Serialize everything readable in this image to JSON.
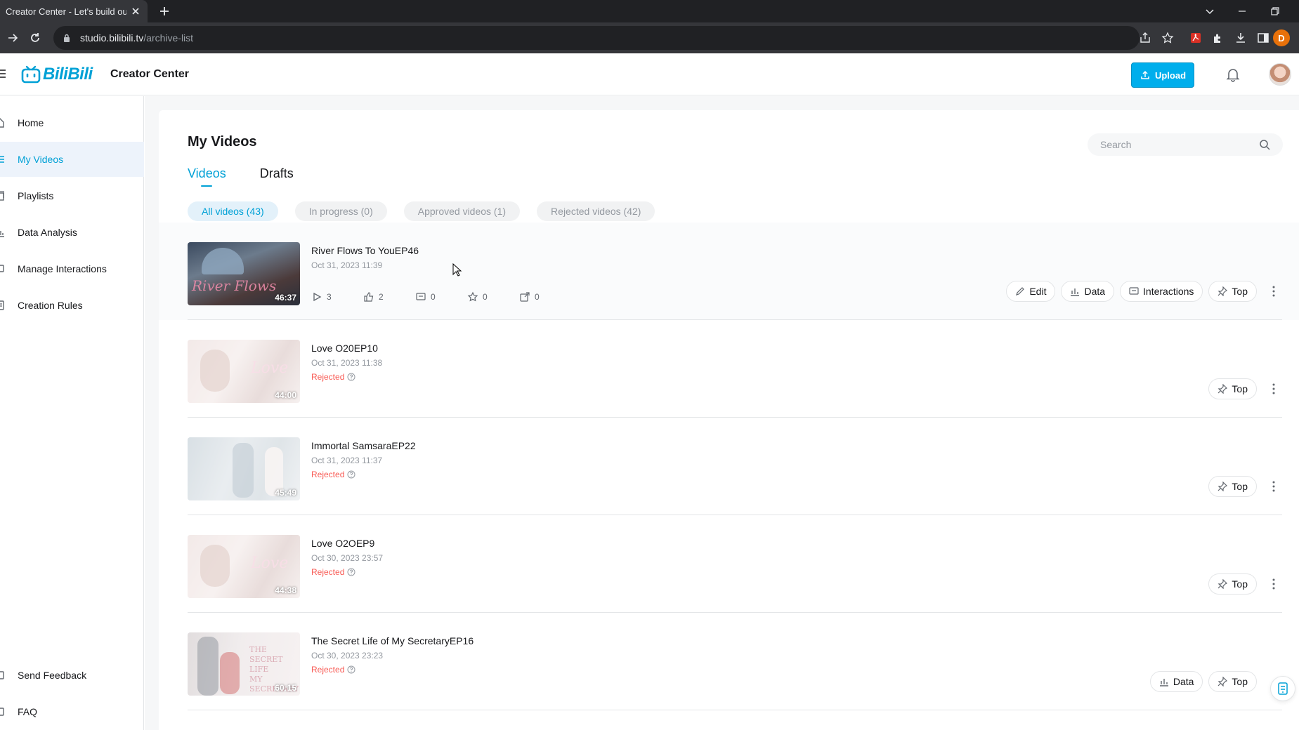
{
  "browser": {
    "tab_title": "Creator Center - Let's build our",
    "url_host": "studio.bilibili.tv",
    "url_path": "/archive-list",
    "profile_initial": "D"
  },
  "header": {
    "logo_text": "BiliBili",
    "title": "Creator Center",
    "upload_label": "Upload"
  },
  "sidebar": {
    "items": [
      {
        "label": "Home",
        "icon": "home-icon"
      },
      {
        "label": "My Videos",
        "icon": "list-icon"
      },
      {
        "label": "Playlists",
        "icon": "playlist-icon"
      },
      {
        "label": "Data Analysis",
        "icon": "chart-icon"
      },
      {
        "label": "Manage Interactions",
        "icon": "comment-icon"
      },
      {
        "label": "Creation Rules",
        "icon": "rules-icon"
      }
    ],
    "bottom": [
      {
        "label": "Send Feedback",
        "icon": "feedback-icon"
      },
      {
        "label": "FAQ",
        "icon": "faq-icon"
      }
    ]
  },
  "main": {
    "title": "My Videos",
    "search_placeholder": "Search",
    "tabs": [
      "Videos",
      "Drafts"
    ],
    "filters": [
      "All videos (43)",
      "In progress (0)",
      "Approved videos (1)",
      "Rejected videos (42)"
    ],
    "videos": [
      {
        "title": "River Flows To YouEP46",
        "date": "Oct 31, 2023 11:39",
        "duration": "46:37",
        "status": "",
        "stats": {
          "views": "3",
          "likes": "2",
          "comments": "0",
          "favorites": "0",
          "shares": "0"
        },
        "actions": [
          "Edit",
          "Data",
          "Interactions",
          "Top"
        ]
      },
      {
        "title": "Love O20EP10",
        "date": "Oct 31, 2023 11:38",
        "duration": "44:00",
        "status": "Rejected",
        "actions": [
          "Top"
        ]
      },
      {
        "title": "Immortal SamsaraEP22",
        "date": "Oct 31, 2023 11:37",
        "duration": "45:49",
        "status": "Rejected",
        "actions": [
          "Top"
        ]
      },
      {
        "title": "Love O2OEP9",
        "date": "Oct 30, 2023 23:57",
        "duration": "44:38",
        "status": "Rejected",
        "actions": [
          "Top"
        ]
      },
      {
        "title": "The Secret Life of My SecretaryEP16",
        "date": "Oct 30, 2023 23:23",
        "duration": "60:15",
        "status": "Rejected",
        "actions": [
          "Data",
          "Top"
        ]
      }
    ]
  },
  "colors": {
    "accent": "#00a1d6",
    "upload": "#00aeec",
    "rejected": "#f85a54"
  }
}
